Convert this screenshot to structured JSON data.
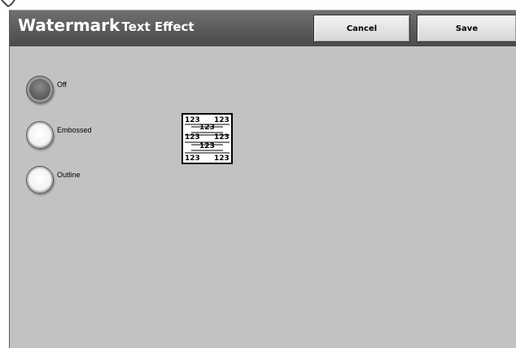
{
  "header": {
    "title": "Watermark",
    "subtitle": "- Text Effect",
    "cancel_label": "Cancel",
    "save_label": "Save"
  },
  "options": [
    {
      "label": "Off",
      "selected": true
    },
    {
      "label": "Embossed",
      "selected": false
    },
    {
      "label": "Outline",
      "selected": false
    }
  ],
  "preview": {
    "left_text": "123",
    "right_text": "123",
    "center_text": "123"
  },
  "colors": {
    "title_bar": "#555555",
    "screen_background": "#c2c2c2",
    "selected_radio": "#5d5d5d"
  }
}
